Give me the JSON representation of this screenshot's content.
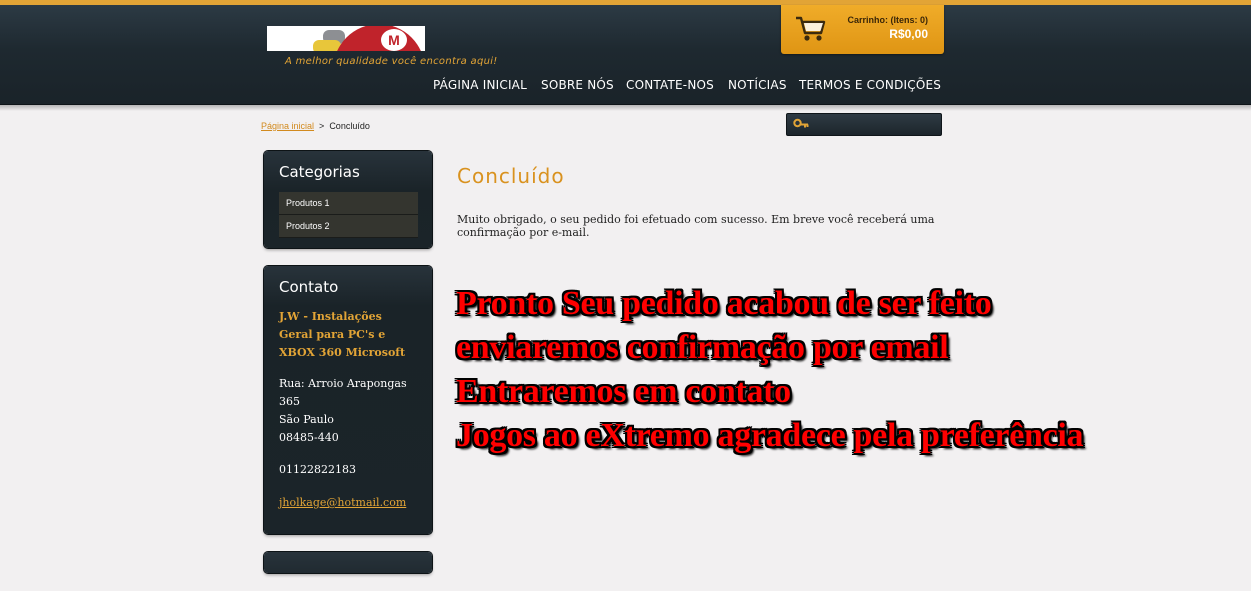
{
  "header": {
    "logo_letter": "M",
    "tagline": "A melhor qualidade você encontra aqui!",
    "nav": [
      {
        "label": "PÁGINA INICIAL"
      },
      {
        "label": "SOBRE NÓS"
      },
      {
        "label": "CONTATE-NOS"
      },
      {
        "label": "NOTÍCIAS"
      },
      {
        "label": "TERMOS E CONDIÇÕES"
      }
    ],
    "cart": {
      "label": "Carrinho: (Itens: 0)",
      "total": "R$0,00"
    }
  },
  "breadcrumb": {
    "home": "Página inicial",
    "separator": ">",
    "current": "Concluído"
  },
  "search": {
    "value": "",
    "placeholder": ""
  },
  "sidebar": {
    "categories": {
      "title": "Categorias",
      "items": [
        {
          "label": "Produtos 1"
        },
        {
          "label": "Produtos 2"
        }
      ]
    },
    "contact": {
      "title": "Contato",
      "company": [
        "J.W - Instalações",
        "Geral para PC's e",
        "XBOX 360 Microsoft"
      ],
      "address": [
        "Rua: Arroio Arapongas",
        "365",
        "São Paulo",
        "08485-440"
      ],
      "phone": "01122822183",
      "email": "jholkage@hotmail.com"
    }
  },
  "main": {
    "title": "Concluído",
    "message_lines": [
      "Muito obrigado, o seu pedido foi efetuado com sucesso. Em breve você receberá uma",
      "confirmação por e-mail."
    ],
    "overlay_lines": [
      "Pronto Seu pedido acabou de ser feito",
      "enviaremos confirmação por email",
      "Entraremos em contato",
      "Jogos ao eXtremo agradece pela preferência"
    ]
  },
  "colors": {
    "accent": "#e2a436",
    "header_bg": "#1e2930",
    "overlay_text": "#ff0000"
  }
}
